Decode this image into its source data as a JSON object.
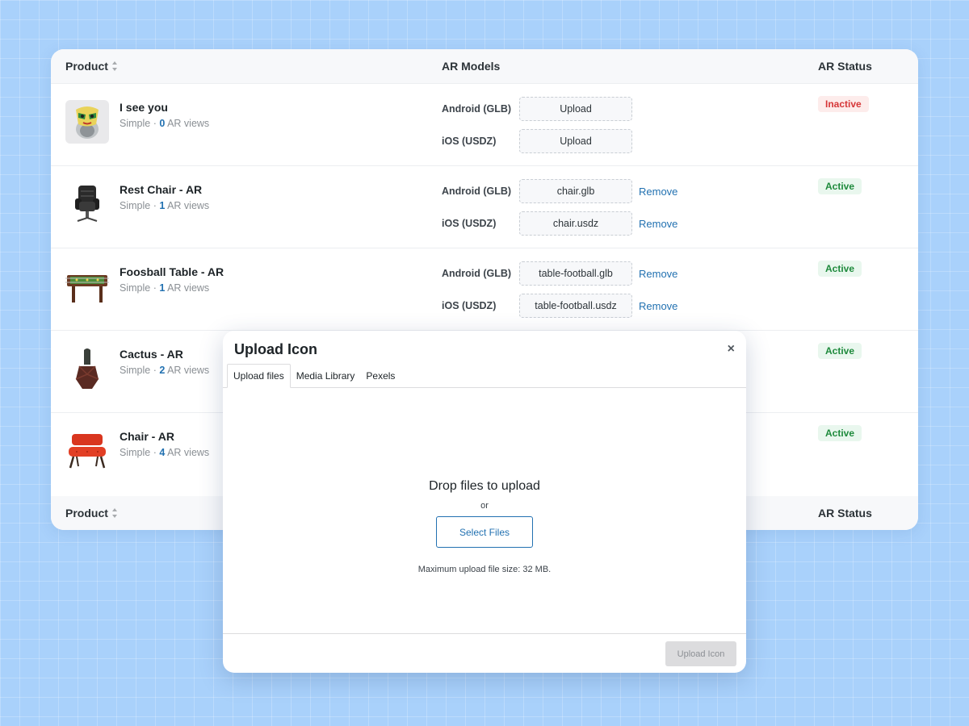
{
  "table": {
    "headers": {
      "product": "Product",
      "models": "AR Models",
      "status": "AR Status"
    },
    "labels": {
      "android": "Android (GLB)",
      "ios": "iOS (USDZ)",
      "remove": "Remove"
    },
    "rows": [
      {
        "name": "I see you",
        "type": "Simple",
        "views": "0",
        "views_suffix": "AR views",
        "android_file": "Upload",
        "ios_file": "Upload",
        "status": "Inactive",
        "icon": "mask-sculpture-icon"
      },
      {
        "name": "Rest Chair - AR",
        "type": "Simple",
        "views": "1",
        "views_suffix": "AR views",
        "android_file": "chair.glb",
        "ios_file": "chair.usdz",
        "status": "Active",
        "icon": "armchair-icon"
      },
      {
        "name": "Foosball Table - AR",
        "type": "Simple",
        "views": "1",
        "views_suffix": "AR views",
        "android_file": "table-football.glb",
        "ios_file": "table-football.usdz",
        "status": "Active",
        "icon": "foosball-table-icon"
      },
      {
        "name": "Cactus - AR",
        "type": "Simple",
        "views": "2",
        "views_suffix": "AR views",
        "status": "Active",
        "icon": "cactus-pot-icon"
      },
      {
        "name": "Chair - AR",
        "type": "Simple",
        "views": "4",
        "views_suffix": "AR views",
        "status": "Active",
        "icon": "red-chair-icon"
      }
    ]
  },
  "modal": {
    "title": "Upload Icon",
    "close": "×",
    "tabs": [
      "Upload files",
      "Media Library",
      "Pexels"
    ],
    "active_tab": "Upload files",
    "drop_title": "Drop files to upload",
    "or": "or",
    "select_button": "Select Files",
    "max_size": "Maximum upload file size: 32 MB.",
    "footer_button": "Upload Icon"
  },
  "colors": {
    "background": "#a9d1fb",
    "link": "#2271b1",
    "active_badge": "#1e8a3c",
    "inactive_badge": "#d63638"
  }
}
